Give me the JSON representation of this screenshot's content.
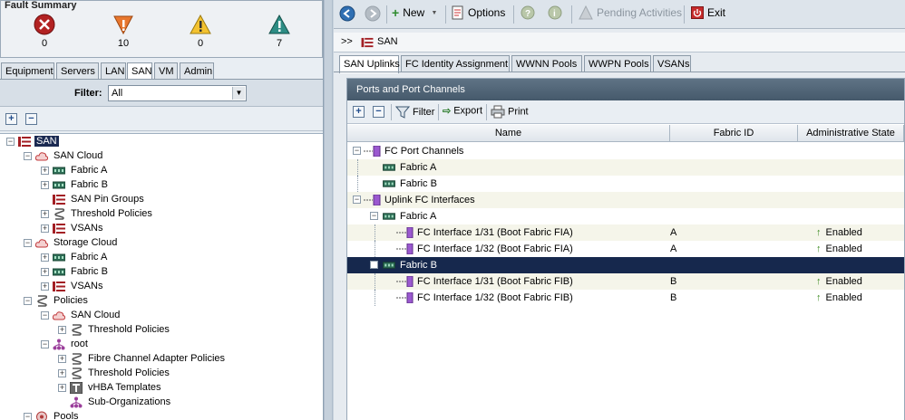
{
  "fault_summary": {
    "title": "Fault Summary",
    "critical": "0",
    "major": "10",
    "minor": "0",
    "warning": "7"
  },
  "left_tabs": [
    "Equipment",
    "Servers",
    "LAN",
    "SAN",
    "VM",
    "Admin"
  ],
  "left_tab_active": "SAN",
  "filter": {
    "label": "Filter:",
    "value": "All"
  },
  "tree": [
    {
      "label": "SAN",
      "icon": "san-icon",
      "selected": true
    },
    {
      "label": "SAN Cloud",
      "icon": "cloud-icon"
    },
    {
      "label": "Fabric A",
      "icon": "fabric-icon"
    },
    {
      "label": "Fabric B",
      "icon": "fabric-icon"
    },
    {
      "label": "SAN Pin Groups",
      "icon": "san-icon"
    },
    {
      "label": "Threshold Policies",
      "icon": "policy-icon"
    },
    {
      "label": "VSANs",
      "icon": "san-icon"
    },
    {
      "label": "Storage Cloud",
      "icon": "cloud-icon"
    },
    {
      "label": "Fabric A",
      "icon": "fabric-icon"
    },
    {
      "label": "Fabric B",
      "icon": "fabric-icon"
    },
    {
      "label": "VSANs",
      "icon": "san-icon"
    },
    {
      "label": "Policies",
      "icon": "policy-icon"
    },
    {
      "label": "SAN Cloud",
      "icon": "cloud-icon"
    },
    {
      "label": "Threshold Policies",
      "icon": "policy-icon"
    },
    {
      "label": "root",
      "icon": "org-icon"
    },
    {
      "label": "Fibre Channel Adapter Policies",
      "icon": "policy-icon"
    },
    {
      "label": "Threshold Policies",
      "icon": "policy-icon"
    },
    {
      "label": "vHBA Templates",
      "icon": "template-icon"
    },
    {
      "label": "Sub-Organizations",
      "icon": "org-icon"
    },
    {
      "label": "Pools",
      "icon": "pool-icon"
    }
  ],
  "toolbar": {
    "new": "New",
    "options": "Options",
    "pending": "Pending Activities",
    "exit": "Exit"
  },
  "breadcrumb": {
    "prefix": ">>",
    "item": "SAN"
  },
  "right_tabs": [
    "SAN Uplinks",
    "FC Identity Assignment",
    "WWNN Pools",
    "WWPN Pools",
    "VSANs"
  ],
  "right_tab_active": "SAN Uplinks",
  "panel": {
    "title": "Ports and Port Channels",
    "filter": "Filter",
    "export": "Export",
    "print": "Print"
  },
  "grid": {
    "columns": [
      "Name",
      "Fabric ID",
      "Administrative State"
    ],
    "rows": [
      {
        "name": "FC Port Channels",
        "fabric": "",
        "state": "",
        "icon": "port-channel-icon",
        "level": 0
      },
      {
        "name": "Fabric A",
        "fabric": "",
        "state": "",
        "icon": "fabric-icon",
        "level": 1
      },
      {
        "name": "Fabric B",
        "fabric": "",
        "state": "",
        "icon": "fabric-icon",
        "level": 1
      },
      {
        "name": "Uplink FC Interfaces",
        "fabric": "",
        "state": "",
        "icon": "port-channel-icon",
        "level": 0
      },
      {
        "name": "Fabric A",
        "fabric": "",
        "state": "",
        "icon": "fabric-icon",
        "level": 1
      },
      {
        "name": "FC Interface 1/31 (Boot Fabric FIA)",
        "fabric": "A",
        "state": "Enabled",
        "icon": "fc-port-icon",
        "level": 2
      },
      {
        "name": "FC Interface 1/32 (Boot Fabric FIA)",
        "fabric": "A",
        "state": "Enabled",
        "icon": "fc-port-icon",
        "level": 2
      },
      {
        "name": "Fabric B",
        "fabric": "",
        "state": "",
        "icon": "fabric-icon",
        "level": 1,
        "selected": true
      },
      {
        "name": "FC Interface 1/31 (Boot Fabric FIB)",
        "fabric": "B",
        "state": "Enabled",
        "icon": "fc-port-icon",
        "level": 2
      },
      {
        "name": "FC Interface 1/32 (Boot Fabric FIB)",
        "fabric": "B",
        "state": "Enabled",
        "icon": "fc-port-icon",
        "level": 2
      }
    ]
  },
  "colors": {
    "selection": "#16284d",
    "panel_header": "#4f6374",
    "enabled_arrow": "#3b8a1f"
  }
}
